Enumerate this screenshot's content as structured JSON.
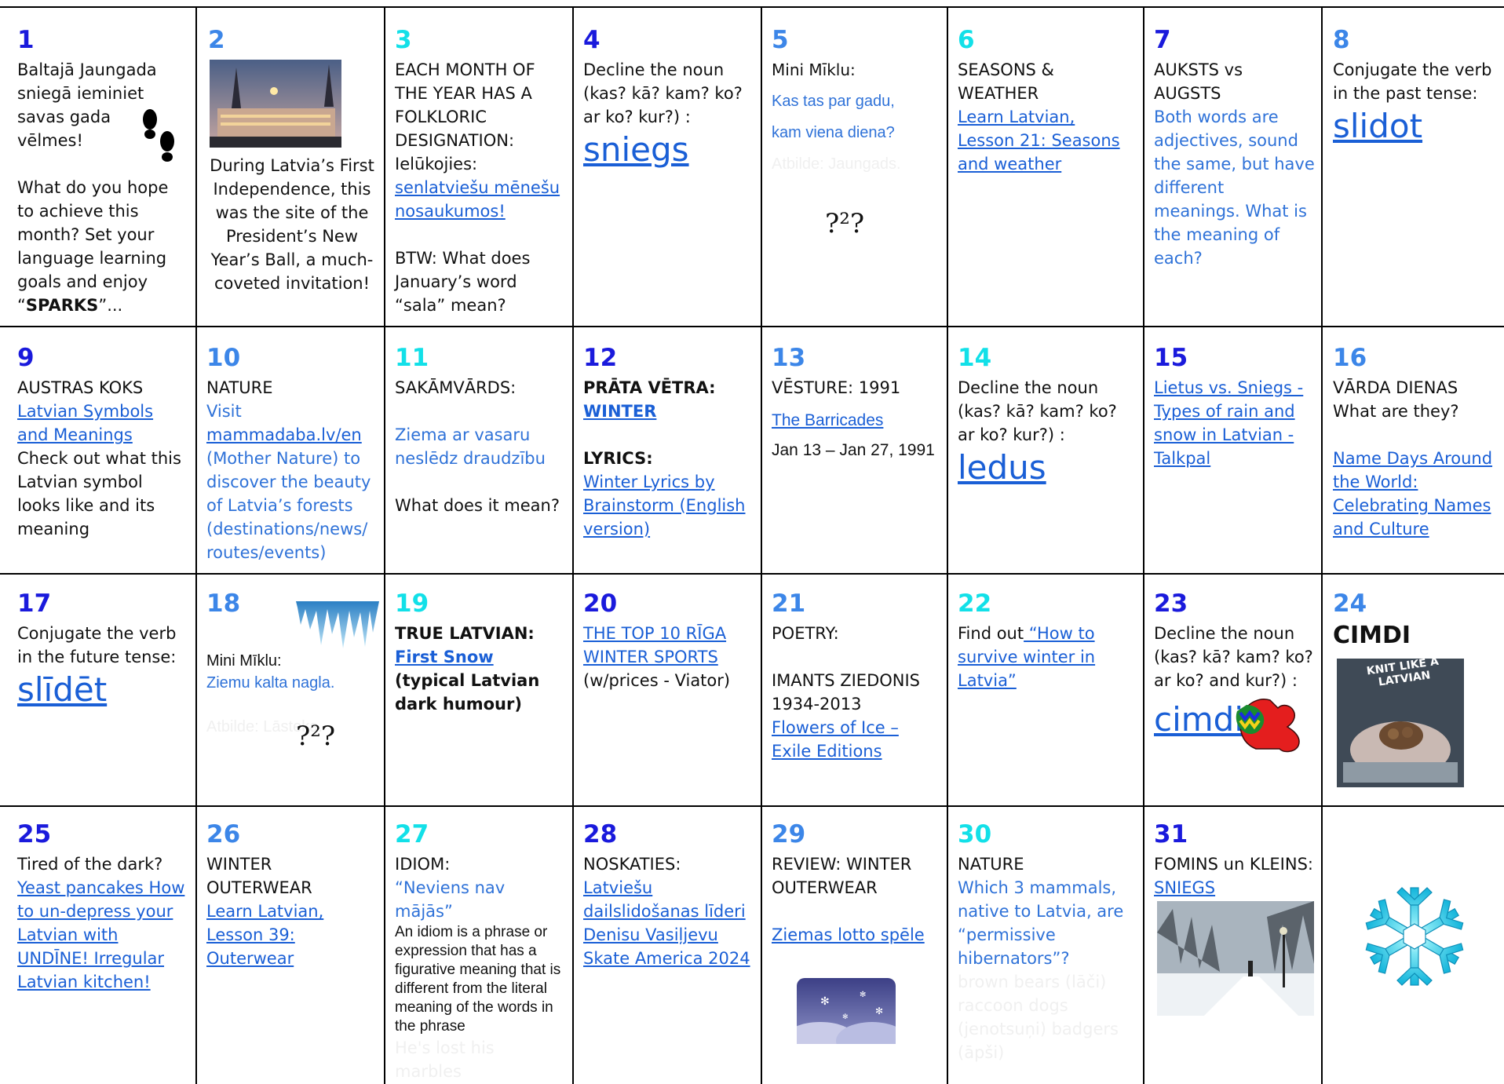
{
  "cells": {
    "d1": {
      "num": "1",
      "l1": "Baltajā Jaungada sniegā ieminiet savas gada vēlmes!",
      "l2": "What do you hope to achieve this month? Set your language learning goals and enjoy “",
      "l3": "SPARKS",
      "l4": "”..."
    },
    "d2": {
      "num": "2",
      "text": "During Latvia’s First Independence, this was the site of the President’s New Year’s Ball, a much-coveted invitation!"
    },
    "d3": {
      "num": "3",
      "l1": "EACH MONTH OF THE YEAR HAS A FOLKLORIC DESIGNATION:",
      "l2": "Ielūkojies:",
      "link": "senlatviešu mēnešu nosaukumos!",
      "l3": "BTW: What does January’s word “sala” mean?"
    },
    "d4": {
      "num": "4",
      "l1": "Decline the noun (kas? kā? kam? ko? ar ko? kur?) :",
      "big": "sniegs"
    },
    "d5": {
      "num": "5",
      "l1": "Mini Mīklu:",
      "l2": "Kas tas par gadu,",
      "l3": "kam viena diena?",
      "hidden": "Atbilde: Jaungads.",
      "qm": "?²?"
    },
    "d6": {
      "num": "6",
      "l1": "SEASONS & WEATHER",
      "link": "Learn Latvian, Lesson 21: Seasons and weather"
    },
    "d7": {
      "num": "7",
      "l1": "AUKSTS vs AUGSTS",
      "l2": "Both words are adjectives, sound the same, but have different meanings. What is the meaning of each?"
    },
    "d8": {
      "num": "8",
      "l1": "Conjugate the verb in the past tense:",
      "big": "slidot"
    },
    "d9": {
      "num": "9",
      "l1": "AUSTRAS KOKS",
      "link": "Latvian Symbols and Meanings",
      "l2": "Check out what this Latvian symbol looks like and its meaning"
    },
    "d10": {
      "num": "10",
      "l1": "NATURE",
      "l2": "Visit",
      "link": "mammadaba.lv/en",
      "l3": "(Mother Nature) to discover the  beauty of Latvia’s forests (destinations/news/ routes/events)"
    },
    "d11": {
      "num": "11",
      "l1": "SAKĀMVĀRDS:",
      "l2": "Ziema ar vasaru neslēdz draudzību",
      "l3": "What does it mean?"
    },
    "d12": {
      "num": "12",
      "l1": "PRĀTA VĒTRA:",
      "link1": "WINTER",
      "l2": "LYRICS:",
      "link2": "Winter Lyrics by Brainstorm (English version)"
    },
    "d13": {
      "num": "13",
      "l1": "VĒSTURE: 1991",
      "link": "The Barricades",
      "l2": "Jan 13 – Jan 27, 1991"
    },
    "d14": {
      "num": "14",
      "l1": "Decline the noun (kas? kā? kam? ko? ar ko? kur?) :",
      "big": "ledus"
    },
    "d15": {
      "num": "15",
      "link": "Lietus vs. Sniegs - Types of rain and snow in Latvian - Talkpal"
    },
    "d16": {
      "num": "16",
      "l1": "VĀRDA DIENAS",
      "l2": "What are they?",
      "link": "Name Days Around the World: Celebrating Names and Culture"
    },
    "d17": {
      "num": "17",
      "l1": "Conjugate the verb in the future tense:",
      "big": "slīdēt"
    },
    "d18": {
      "num": "18",
      "l1": "Mini Mīklu:",
      "l2": "Ziemu kalta nagla.",
      "hidden": "Atbilde: Lāsteka.",
      "qm": "?²?"
    },
    "d19": {
      "num": "19",
      "l1": "TRUE LATVIAN:",
      "link": "First Snow",
      "l2": "(typical Latvian dark humour)"
    },
    "d20": {
      "num": "20",
      "link": "THE TOP 10 RĪGA WINTER SPORTS",
      "l1": "(w/prices - Viator)"
    },
    "d21": {
      "num": "21",
      "l1": "POETRY:",
      "l2": "IMANTS ZIEDONIS 1934-2013",
      "link": "Flowers of Ice – Exile Editions"
    },
    "d22": {
      "num": "22",
      "l1": "Find out",
      "link": " “How to survive winter in Latvia”"
    },
    "d23": {
      "num": "23",
      "l1": "Decline the noun (kas? kā? kam? ko? ar ko? and kur?) :",
      "big": "cimdi"
    },
    "d24": {
      "num": "24",
      "l1": "CIMDI",
      "book": "KNIT LIKE A LATVIAN"
    },
    "d25": {
      "num": "25",
      "l1": "Tired of the dark?",
      "link": "Yeast pancakes How to un-depress your Latvian with UNDĪNE! Irregular Latvian kitchen!"
    },
    "d26": {
      "num": "26",
      "l1": "WINTER OUTERWEAR",
      "link": "Learn Latvian, Lesson 39: Outerwear"
    },
    "d27": {
      "num": "27",
      "l1": "IDIOM:",
      "l2": "“Neviens nav mājās”",
      "l3": "An idiom is a phrase or expression that has a figurative meaning that is different from the literal meaning of the words in the phrase",
      "hidden": "He's lost his marbles"
    },
    "d28": {
      "num": "28",
      "l1": "NOSKATIES:",
      "link": "Latviešu dailslidošanas līderi Denisu Vasiļjevu Skate America 2024"
    },
    "d29": {
      "num": "29",
      "l1": "REVIEW: WINTER OUTERWEAR",
      "link": "Ziemas lotto spēle"
    },
    "d30": {
      "num": "30",
      "l1": "NATURE",
      "l2": "Which 3 mammals, native to Latvia, are “permissive hibernators”?",
      "hidden": "brown bears (lāči) raccoon dogs (jenotsuņi) badgers (āpši)"
    },
    "d31": {
      "num": "31",
      "l1": "FOMINS un KLEINS:",
      "link": " SNIEGS"
    }
  },
  "colors": {
    "dark": "#1a1adc",
    "mid": "#3c86e8",
    "cyan": "#12e0e8",
    "link": "#1a5fd6"
  }
}
